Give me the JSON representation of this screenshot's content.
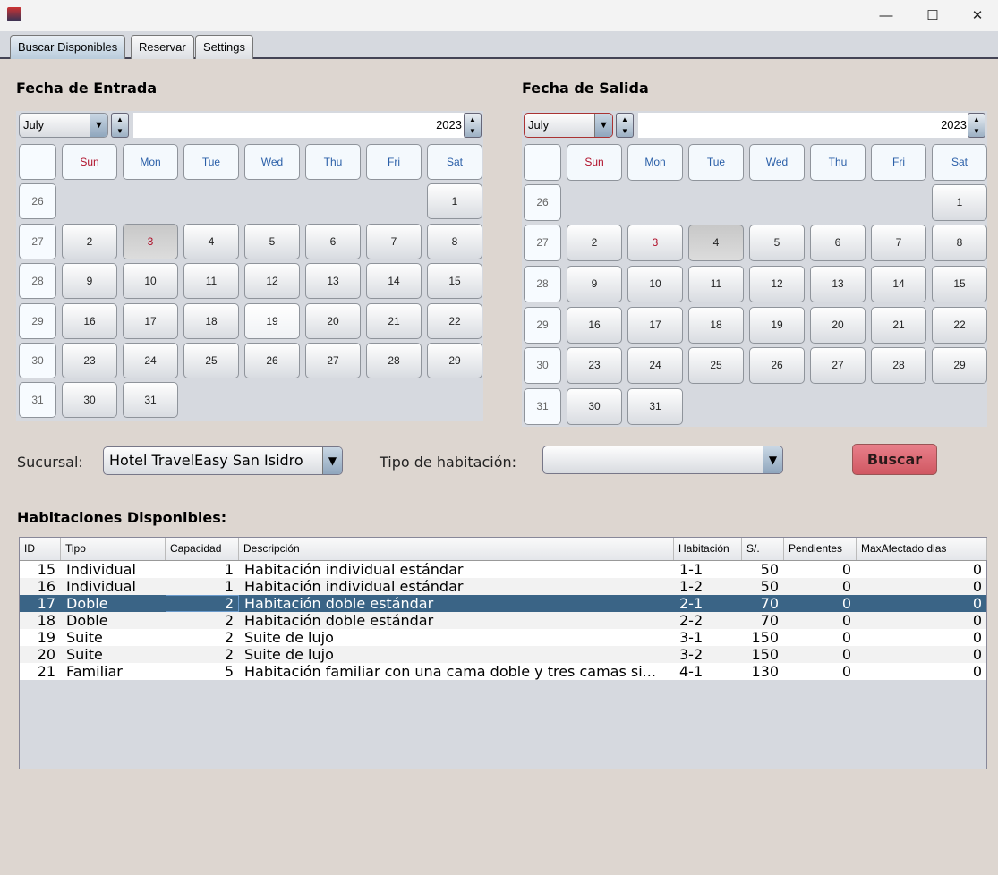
{
  "window": {
    "controls": [
      "—",
      "☐",
      "✕"
    ]
  },
  "tabs": [
    {
      "label": "Buscar Disponibles",
      "active": true
    },
    {
      "label": "Reservar"
    },
    {
      "label": "Settings"
    }
  ],
  "entrada": {
    "title": "Fecha de Entrada",
    "month": "July",
    "year": "2023",
    "selected_day": 3
  },
  "salida": {
    "title": "Fecha de Salida",
    "month": "July",
    "year": "2023",
    "selected_day": 4,
    "red_day": 3
  },
  "calendar": {
    "weekdays": [
      "Sun",
      "Mon",
      "Tue",
      "Wed",
      "Thu",
      "Fri",
      "Sat"
    ],
    "weeks": [
      "26",
      "27",
      "28",
      "29",
      "30",
      "31"
    ],
    "first_weekday": 6,
    "days_in_month": 31
  },
  "filters": {
    "sucursal_label": "Sucursal:",
    "sucursal_value": "Hotel TravelEasy San Isidro",
    "tipo_label": "Tipo de habitación:",
    "tipo_value": "",
    "buscar_label": "Buscar"
  },
  "results": {
    "title": "Habitaciones Disponibles:",
    "columns": [
      "ID",
      "Tipo",
      "Capacidad",
      "Descripción",
      "Habitación",
      "S/.",
      "Pendientes",
      "MaxAfectado dias"
    ],
    "selected_row": 2,
    "rows": [
      [
        "15",
        "Individual",
        "1",
        "Habitación individual estándar",
        "1-1",
        "50",
        "0",
        "0"
      ],
      [
        "16",
        "Individual",
        "1",
        "Habitación individual estándar",
        "1-2",
        "50",
        "0",
        "0"
      ],
      [
        "17",
        "Doble",
        "2",
        "Habitación doble estándar",
        "2-1",
        "70",
        "0",
        "0"
      ],
      [
        "18",
        "Doble",
        "2",
        "Habitación doble estándar",
        "2-2",
        "70",
        "0",
        "0"
      ],
      [
        "19",
        "Suite",
        "2",
        "Suite de lujo",
        "3-1",
        "150",
        "0",
        "0"
      ],
      [
        "20",
        "Suite",
        "2",
        "Suite de lujo",
        "3-2",
        "150",
        "0",
        "0"
      ],
      [
        "21",
        "Familiar",
        "5",
        "Habitación familiar con una cama doble y tres camas si...",
        "4-1",
        "130",
        "0",
        "0"
      ]
    ]
  },
  "colors": {
    "selection": "#3a6486",
    "buscar": "#d9646e",
    "sunday": "#b0102a",
    "weekday": "#2a5fa8"
  }
}
